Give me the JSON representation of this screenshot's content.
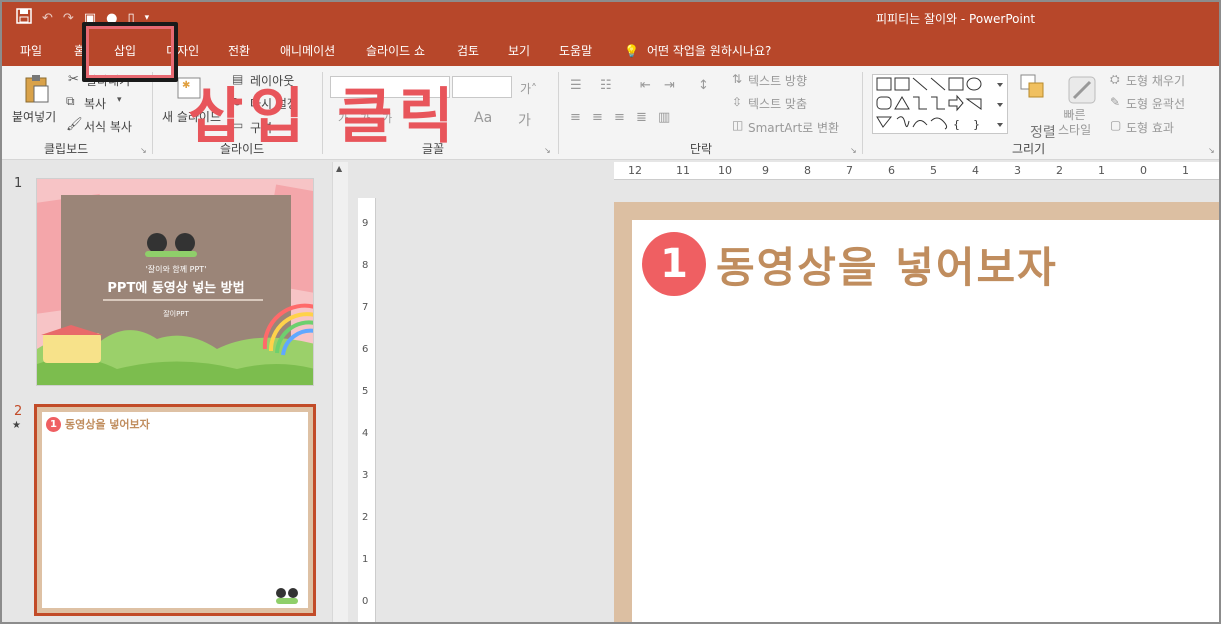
{
  "titlebar": {
    "app_title": "피피티는 잘이와  -  PowerPoint",
    "qat_icons": [
      "save-icon",
      "undo-icon",
      "redo-icon",
      "present-icon",
      "pin-icon",
      "new-doc-icon",
      "customize-icon"
    ]
  },
  "tabs": [
    "파일",
    "홈",
    "삽입",
    "디자인",
    "전환",
    "애니메이션",
    "슬라이드 쇼",
    "검토",
    "보기",
    "도움말"
  ],
  "tell_me": "어떤 작업을 원하시나요?",
  "ribbon": {
    "clipboard": {
      "paste": "붙여넣기",
      "cut": "잘라내기",
      "copy": "복사",
      "format_painter": "서식 복사",
      "label": "클립보드"
    },
    "slides": {
      "new_slide": "새 슬라이드",
      "layout": "레이아웃",
      "reset": "다시 설정",
      "section": "구역",
      "label": "슬라이드"
    },
    "font": {
      "label": "글꼴"
    },
    "paragraph": {
      "text_direction": "텍스트 방향",
      "align_text": "텍스트 맞춤",
      "smartart": "SmartArt로 변환",
      "label": "단락"
    },
    "drawing": {
      "arrange": "정렬",
      "quick_styles": "빠른\n스타일",
      "shape_fill": "도형 채우기",
      "shape_outline": "도형 윤곽선",
      "shape_effects": "도형 효과",
      "label": "그리기"
    }
  },
  "annotation": {
    "overlay_text": "삽입 클릭"
  },
  "ruler": {
    "h_labels": [
      "12",
      "11",
      "10",
      "9",
      "8",
      "7",
      "6",
      "5",
      "4",
      "3",
      "2",
      "1",
      "0",
      "1"
    ],
    "v_labels": [
      "9",
      "8",
      "7",
      "6",
      "5",
      "4",
      "3",
      "2",
      "1",
      "0"
    ]
  },
  "slides_pane": [
    {
      "number": "1",
      "title_small": "'잘이와 함께 PPT'",
      "title_main": "PPT에 동영상 넣는 방법",
      "author": "잘이PPT"
    },
    {
      "number": "2",
      "star": "★",
      "badge": "1",
      "title": "동영상을 넣어보자"
    }
  ],
  "editor": {
    "badge": "1",
    "title": "동영상을 넣어보자"
  },
  "colors": {
    "accent": "#b7472a",
    "badge": "#ef5f62",
    "title_text": "#c08d5e",
    "overlay": "#e8555b"
  }
}
